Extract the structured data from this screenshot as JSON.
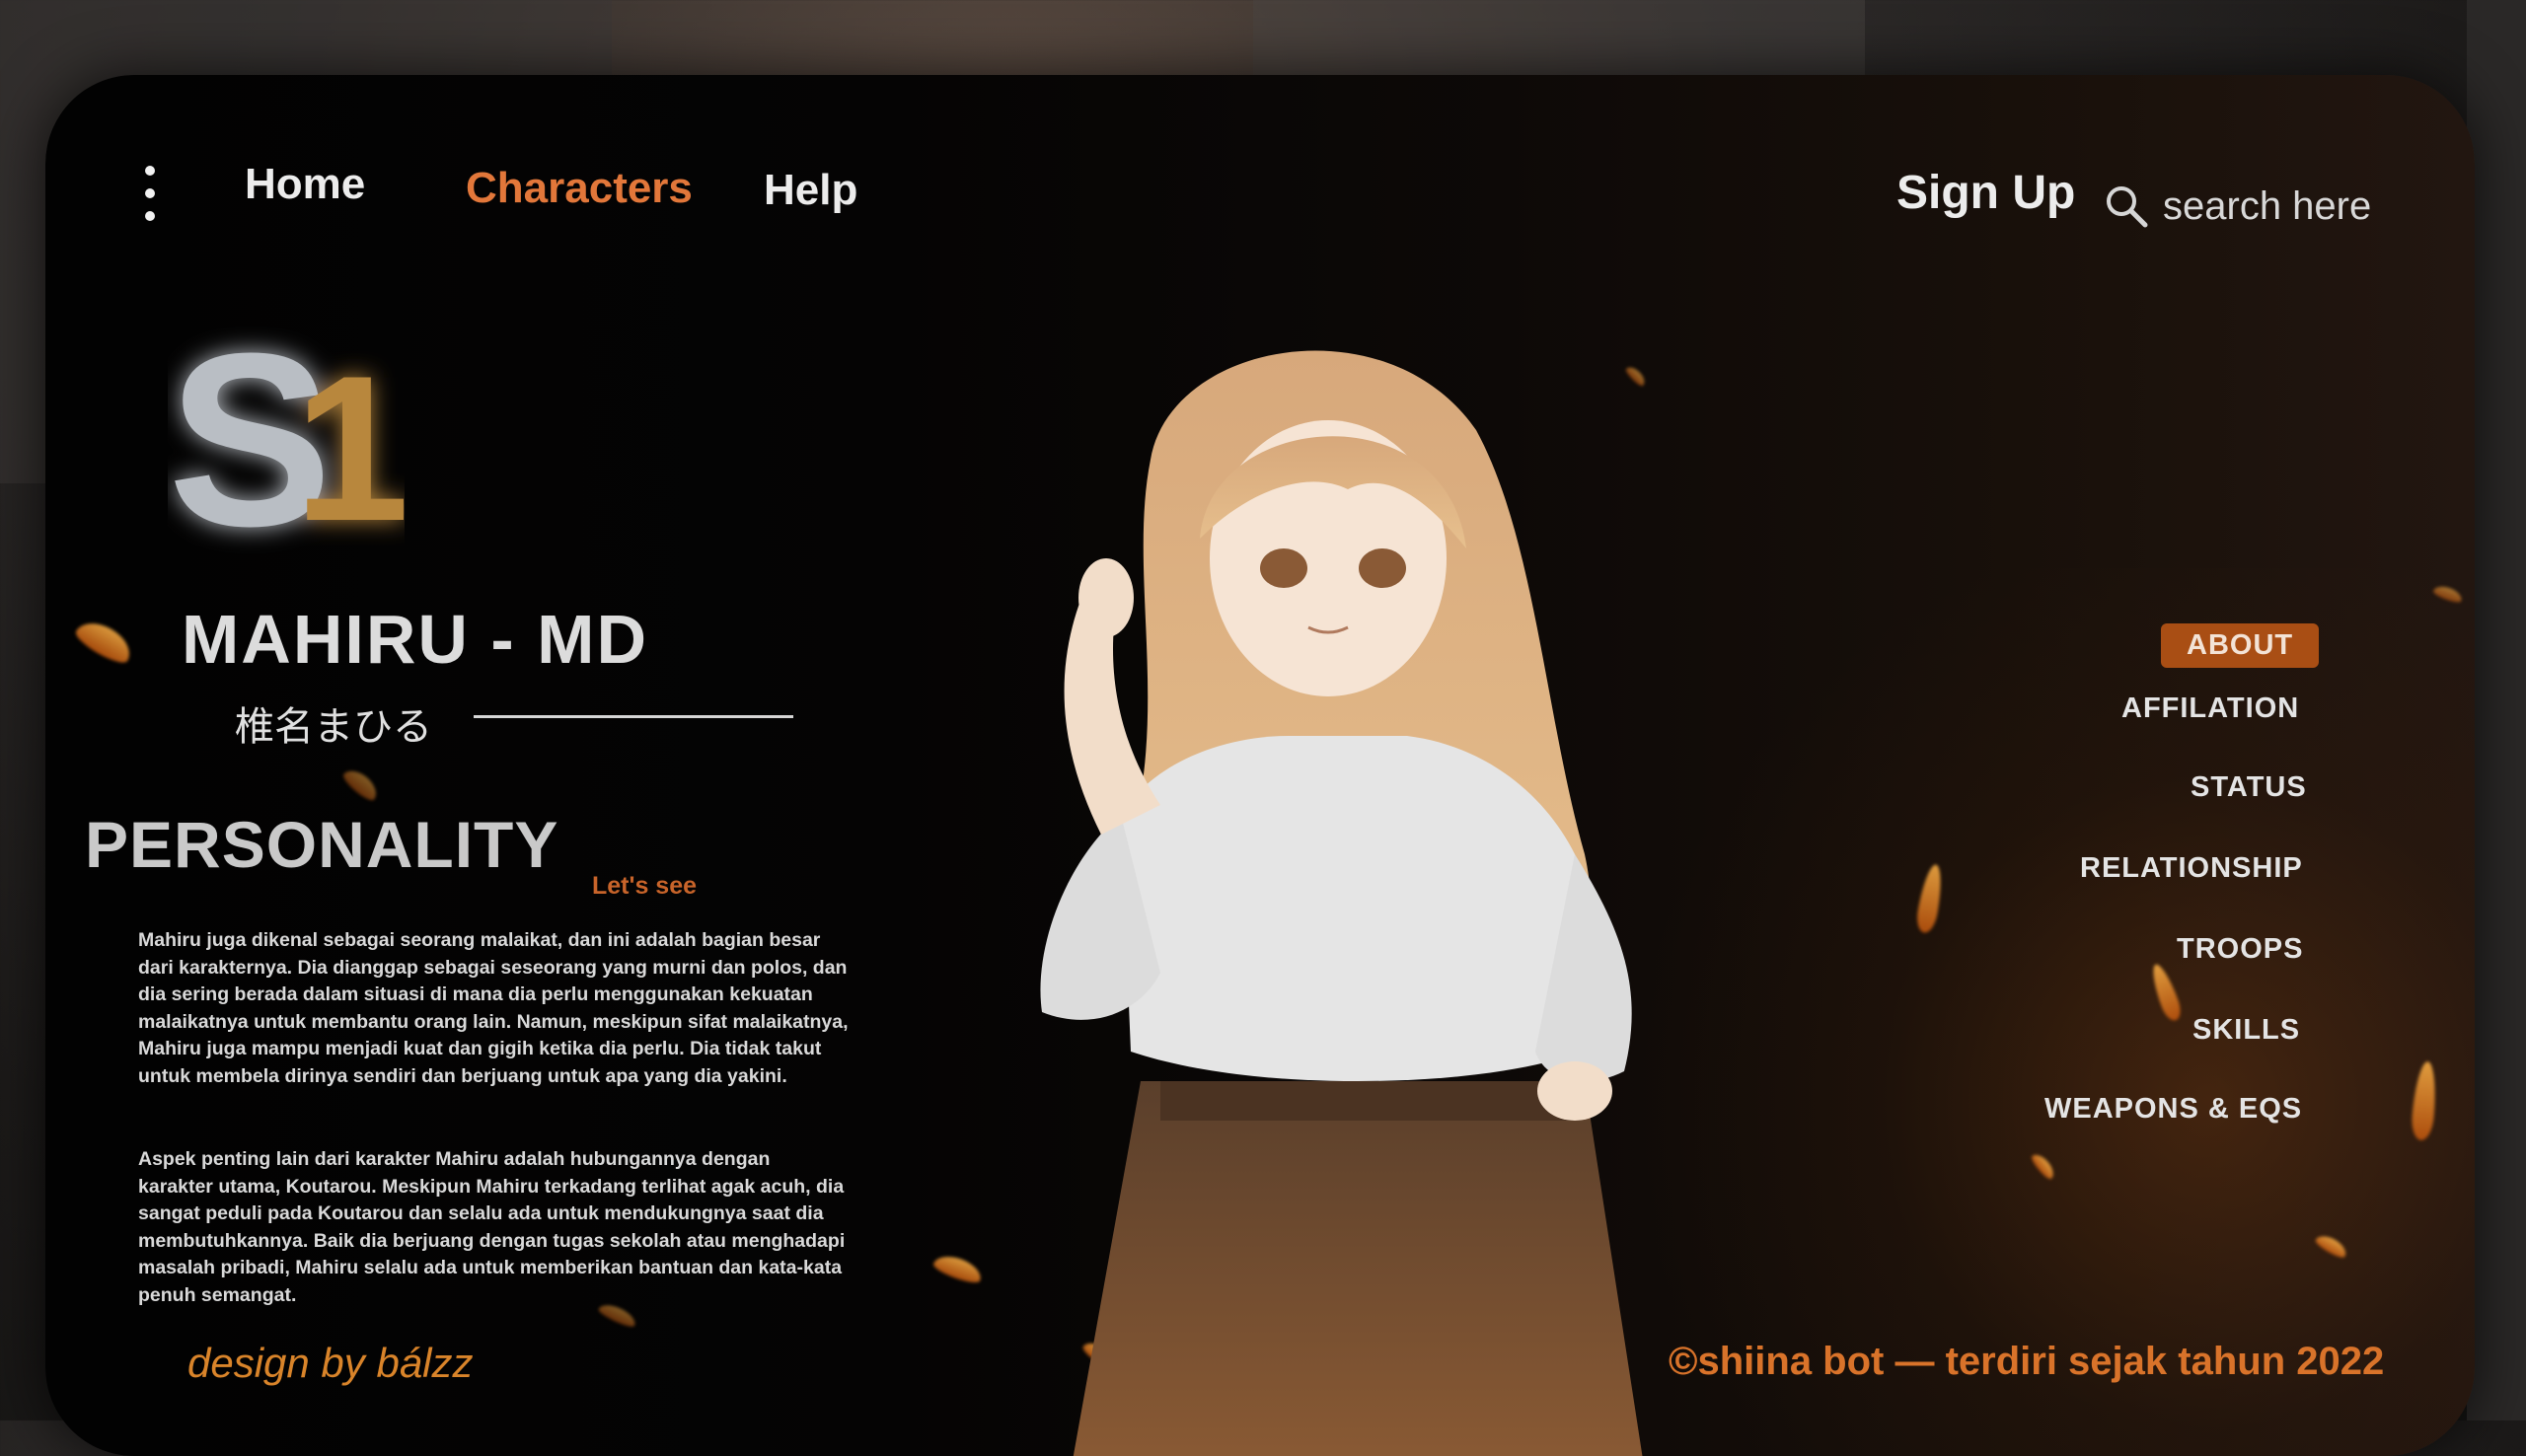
{
  "nav": {
    "links": [
      {
        "label": "Home"
      },
      {
        "label": "Characters"
      },
      {
        "label": "Help"
      }
    ],
    "signup_label": "Sign Up",
    "search_placeholder": "search here"
  },
  "logo": {
    "text_left": "S",
    "text_right": "1"
  },
  "character": {
    "name": "MAHIRU - MD",
    "name_jp": "椎名まひる"
  },
  "personality": {
    "title": "PERSONALITY",
    "subtitle": "Let's see",
    "paragraphs": [
      "Mahiru juga dikenal sebagai seorang malaikat, dan ini adalah bagian besar dari karakternya. Dia dianggap sebagai seseorang yang murni dan polos, dan dia sering berada dalam situasi di mana dia perlu menggunakan kekuatan malaikatnya untuk membantu orang lain. Namun, meskipun sifat malaikatnya, Mahiru juga mampu menjadi kuat dan gigih ketika dia perlu. Dia tidak takut untuk membela dirinya sendiri dan berjuang untuk apa yang dia yakini.",
      "Aspek penting lain dari karakter Mahiru adalah hubungannya dengan karakter utama, Koutarou. Meskipun Mahiru terkadang terlihat agak acuh, dia sangat peduli pada Koutarou dan selalu ada untuk mendukungnya saat dia membutuhkannya. Baik dia berjuang dengan tugas sekolah atau menghadapi masalah pribadi, Mahiru selalu ada untuk memberikan bantuan dan kata-kata penuh semangat."
    ]
  },
  "side_menu": [
    {
      "label": "ABOUT",
      "active": true
    },
    {
      "label": "AFFILATION"
    },
    {
      "label": "STATUS"
    },
    {
      "label": "RELATIONSHIP"
    },
    {
      "label": "TROOPS"
    },
    {
      "label": "SKILLS"
    },
    {
      "label": "WEAPONS & EQS"
    }
  ],
  "footer": {
    "design_credit": "design by bálzz",
    "copyright": "©shiina bot — terdiri sejak tahun 2022"
  },
  "colors": {
    "accent": "#e2773a",
    "active_tab_bg": "#a94e14",
    "credit": "#d9842a"
  }
}
